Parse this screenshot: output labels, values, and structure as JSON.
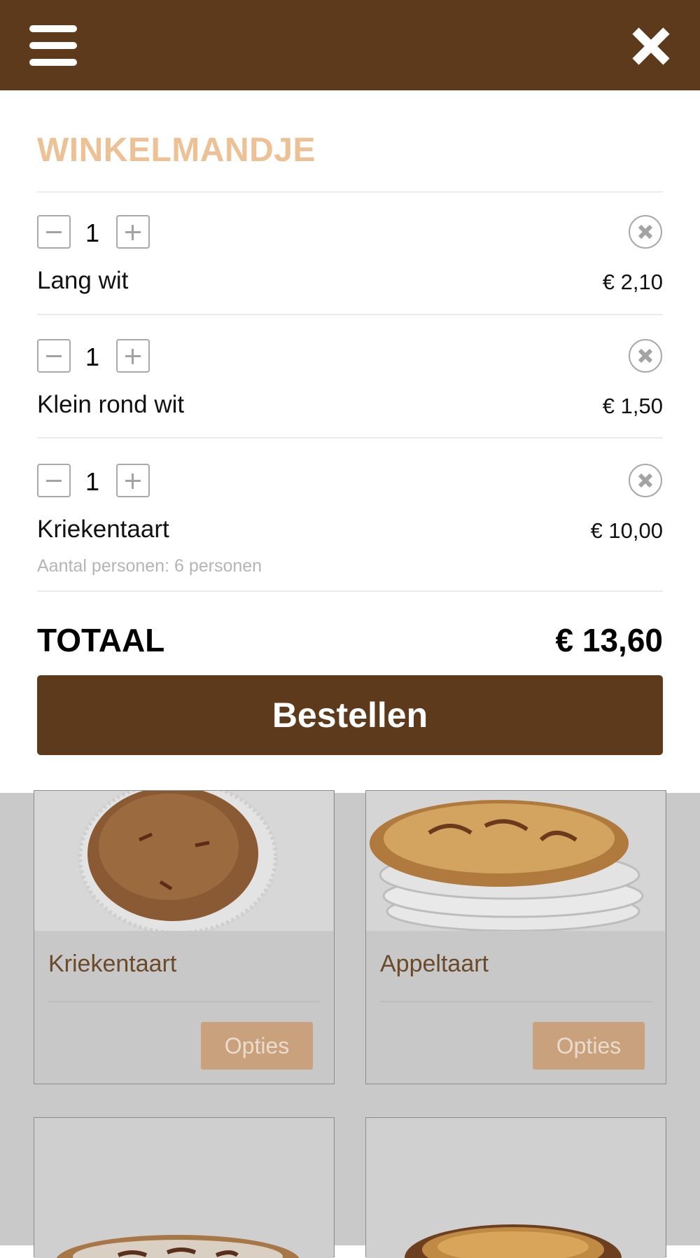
{
  "header": {
    "menu_icon": "hamburger-menu-icon",
    "close_icon": "close-icon"
  },
  "cart": {
    "title": "WINKELMANDJE",
    "items": [
      {
        "quantity": "1",
        "name": "Lang wit",
        "price": "€ 2,10",
        "option": ""
      },
      {
        "quantity": "1",
        "name": "Klein rond wit",
        "price": "€ 1,50",
        "option": ""
      },
      {
        "quantity": "1",
        "name": "Kriekentaart",
        "price": "€ 10,00",
        "option": "Aantal personen: 6 personen"
      }
    ],
    "total_label": "TOTAAL",
    "total_value": "€ 13,60",
    "order_label": "Bestellen"
  },
  "products": [
    {
      "name": "Kriekentaart",
      "button": "Opties"
    },
    {
      "name": "Appeltaart",
      "button": "Opties"
    },
    {
      "name": "",
      "button": ""
    },
    {
      "name": "",
      "button": ""
    }
  ],
  "colors": {
    "brand_brown": "#5e3a1c",
    "title_peach": "#ecc196",
    "opties_button": "#c9a17c"
  }
}
